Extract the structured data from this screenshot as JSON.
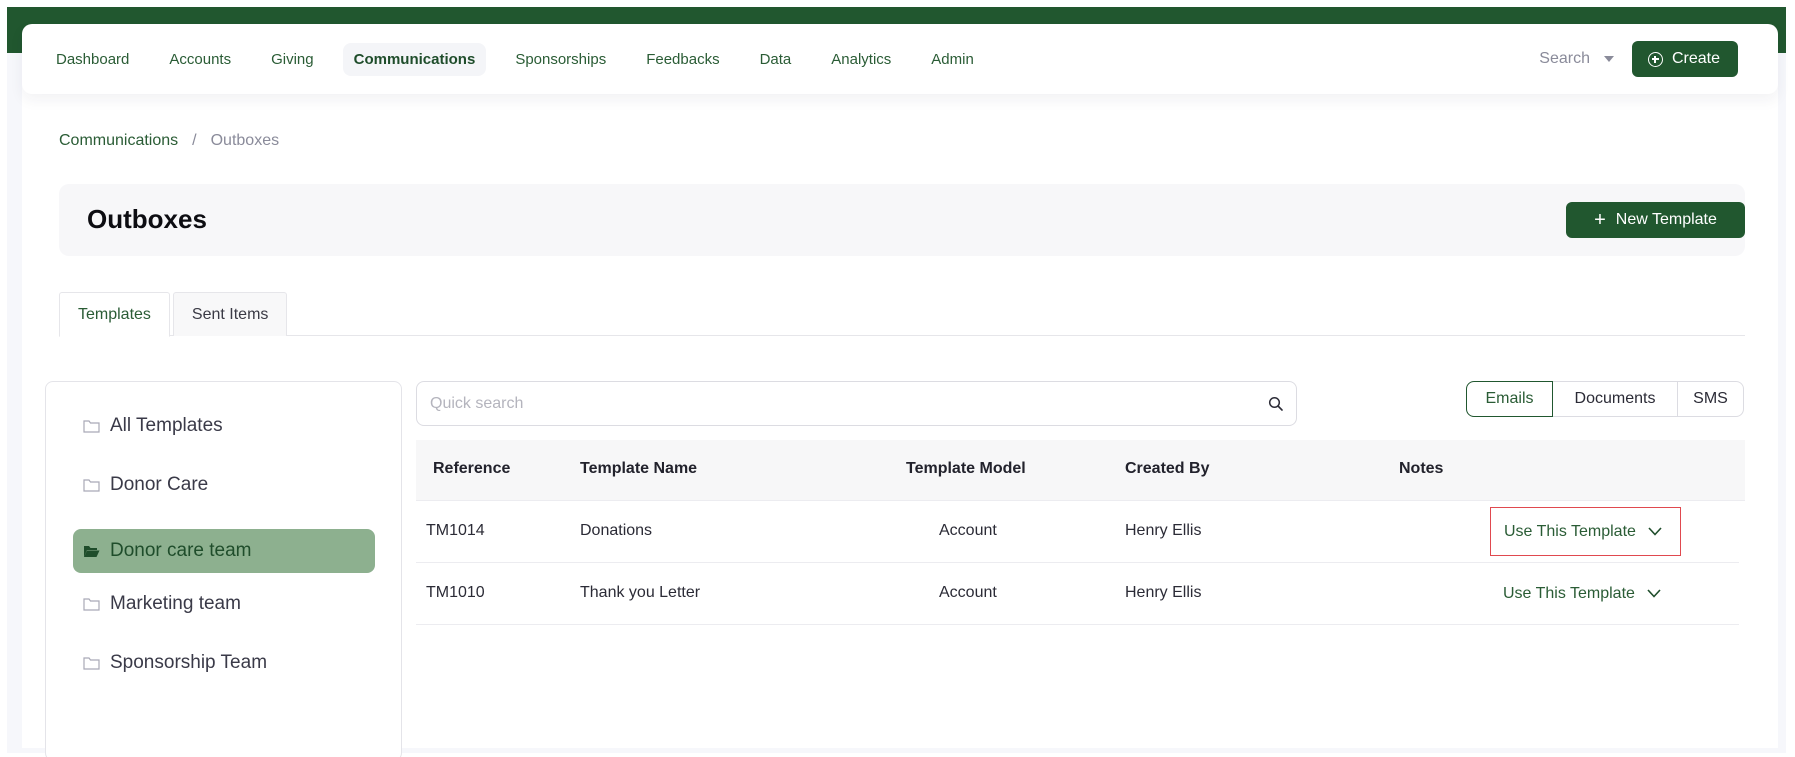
{
  "nav": {
    "items": [
      {
        "label": "Dashboard",
        "active": false
      },
      {
        "label": "Accounts",
        "active": false
      },
      {
        "label": "Giving",
        "active": false
      },
      {
        "label": "Communications",
        "active": true
      },
      {
        "label": "Sponsorships",
        "active": false
      },
      {
        "label": "Feedbacks",
        "active": false
      },
      {
        "label": "Data",
        "active": false
      },
      {
        "label": "Analytics",
        "active": false
      },
      {
        "label": "Admin",
        "active": false
      }
    ],
    "search_label": "Search",
    "create_label": "Create"
  },
  "breadcrumb": {
    "parent": "Communications",
    "separator": "/",
    "current": "Outboxes"
  },
  "header": {
    "title": "Outboxes",
    "new_template_label": "New Template"
  },
  "tabs": [
    {
      "label": "Templates",
      "active": true
    },
    {
      "label": "Sent Items",
      "active": false
    }
  ],
  "folders": [
    {
      "label": "All Templates",
      "active": false
    },
    {
      "label": "Donor Care",
      "active": false
    },
    {
      "label": "Donor care team",
      "active": true
    },
    {
      "label": "Marketing team",
      "active": false
    },
    {
      "label": "Sponsorship Team",
      "active": false
    }
  ],
  "search": {
    "placeholder": "Quick search",
    "value": ""
  },
  "type_filter": {
    "options": [
      "Emails",
      "Documents",
      "SMS"
    ],
    "selected": "Emails"
  },
  "table": {
    "columns": [
      "Reference",
      "Template Name",
      "Template Model",
      "Created By",
      "Notes"
    ],
    "rows": [
      {
        "reference": "TM1014",
        "name": "Donations",
        "model": "Account",
        "created_by": "Henry Ellis",
        "notes": "",
        "action": "Use This Template"
      },
      {
        "reference": "TM1010",
        "name": "Thank you Letter",
        "model": "Account",
        "created_by": "Henry Ellis",
        "notes": "",
        "action": "Use This Template"
      }
    ]
  },
  "colors": {
    "brand": "#21572f",
    "active_folder": "#8db08f",
    "highlight": "#e0494f"
  }
}
